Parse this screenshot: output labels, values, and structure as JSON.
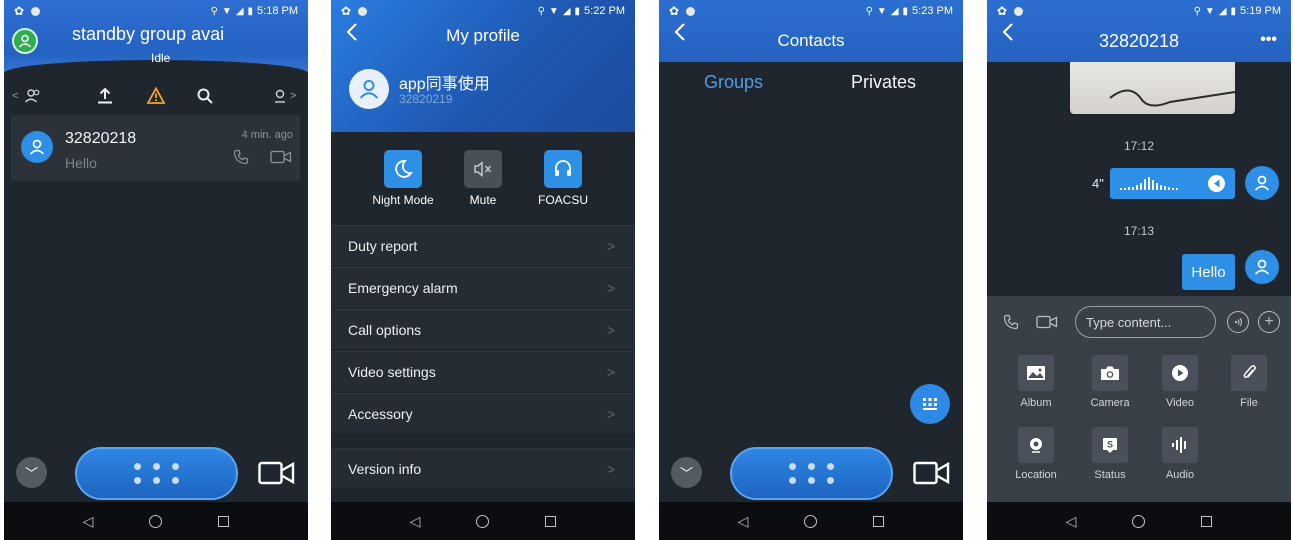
{
  "status_bars": [
    {
      "time": "5:18 PM"
    },
    {
      "time": "5:22 PM"
    },
    {
      "time": "5:23 PM"
    },
    {
      "time": "5:19 PM"
    }
  ],
  "home": {
    "title": "standby group avai",
    "status": "Idle",
    "toolbar_icons": [
      "users-icon",
      "upload-icon",
      "warning-icon",
      "search-icon",
      "location-icon"
    ],
    "toolbar_arrows": {
      "left": "<",
      "right": ">"
    },
    "chat": {
      "name": "32820218",
      "message": "Hello",
      "time": "4 min. ago"
    },
    "colors": {
      "accent": "#2d8fe6",
      "warning": "#f5a623",
      "online": "#2fae4f"
    }
  },
  "profile": {
    "title": "My profile",
    "user_name": "app同事使用",
    "user_id": "32820219",
    "quick_actions": [
      {
        "label": "Night Mode",
        "icon": "moon-icon"
      },
      {
        "label": "Mute",
        "icon": "mute-icon"
      },
      {
        "label": "FOACSU",
        "icon": "headset-icon"
      }
    ],
    "menu": [
      {
        "label": "Duty report"
      },
      {
        "label": "Emergency alarm"
      },
      {
        "label": "Call options"
      },
      {
        "label": "Video settings"
      },
      {
        "label": "Accessory"
      },
      {
        "label": "Version info"
      }
    ],
    "chevron": ">"
  },
  "contacts": {
    "title": "Contacts",
    "tabs": [
      {
        "label": "Groups",
        "active": true
      },
      {
        "label": "Privates",
        "active": false
      }
    ]
  },
  "chat": {
    "title": "32820218",
    "more": "•••",
    "timestamps": [
      "17:12",
      "17:13"
    ],
    "voice_length": "4\"",
    "text_message": "Hello",
    "input_placeholder": "Type content...",
    "tools": [
      {
        "label": "Album",
        "icon": "album-icon"
      },
      {
        "label": "Camera",
        "icon": "camera-icon"
      },
      {
        "label": "Video",
        "icon": "video-play-icon"
      },
      {
        "label": "File",
        "icon": "paperclip-icon"
      },
      {
        "label": "Location",
        "icon": "location-pin-icon"
      },
      {
        "label": "Status",
        "icon": "status-icon"
      },
      {
        "label": "Audio",
        "icon": "audio-icon"
      }
    ]
  }
}
